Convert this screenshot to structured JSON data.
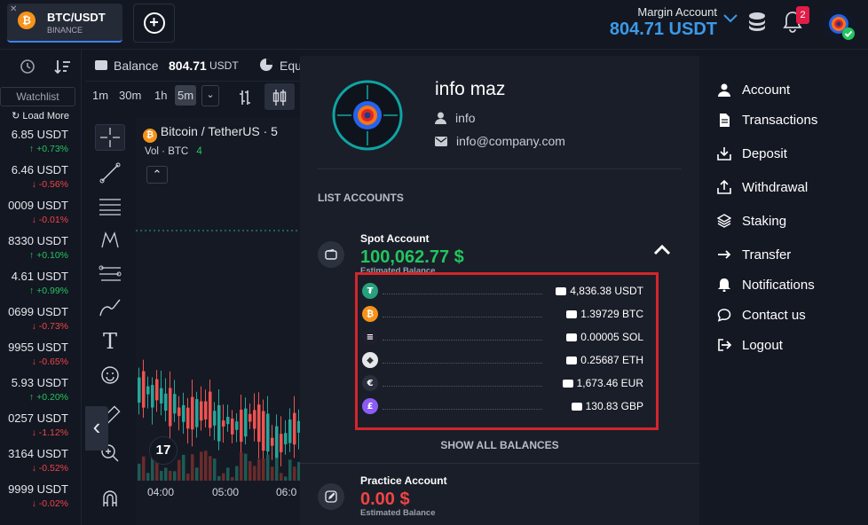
{
  "header": {
    "pair": {
      "symbol": "BTC/USDT",
      "exchange": "BINANCE",
      "coin_letter": "₿"
    },
    "margin_account_label": "Margin Account",
    "margin_account_value": "804.71 USDT",
    "notification_count": "2"
  },
  "sidebar": {
    "watchlist_label": "Watchlist",
    "load_more_label": "Load More",
    "tickers": [
      {
        "price": "6.85 USDT",
        "change": "↑ +0.73%",
        "dir": "up"
      },
      {
        "price": "6.46 USDT",
        "change": "↓ -0.56%",
        "dir": "down"
      },
      {
        "price": "0009 USDT",
        "change": "↓ -0.01%",
        "dir": "down"
      },
      {
        "price": "8330 USDT",
        "change": "↑ +0.10%",
        "dir": "up"
      },
      {
        "price": "4.61 USDT",
        "change": "↑ +0.99%",
        "dir": "up"
      },
      {
        "price": "0699 USDT",
        "change": "↓ -0.73%",
        "dir": "down"
      },
      {
        "price": "9955 USDT",
        "change": "↓ -0.65%",
        "dir": "down"
      },
      {
        "price": "5.93 USDT",
        "change": "↑ +0.20%",
        "dir": "up"
      },
      {
        "price": "0257 USDT",
        "change": "↓ -1.12%",
        "dir": "down"
      },
      {
        "price": "3164 USDT",
        "change": "↓ -0.52%",
        "dir": "down"
      },
      {
        "price": "9999 USDT",
        "change": "↓ -0.02%",
        "dir": "down"
      }
    ]
  },
  "chart_header": {
    "balance_label": "Balance",
    "balance_value": "804.71",
    "balance_unit": "USDT",
    "equity_label": "Equ"
  },
  "timeframes": [
    "1m",
    "30m",
    "1h",
    "5m"
  ],
  "chart": {
    "title": "Bitcoin / TetherUS · 5",
    "vol_label": "Vol · BTC",
    "vol_value": "4",
    "time_labels": [
      "04:00",
      "05:00",
      "06:0"
    ]
  },
  "profile": {
    "name": "info maz",
    "username": "info",
    "email": "info@company.com"
  },
  "accounts": {
    "list_label": "LIST ACCOUNTS",
    "spot": {
      "name": "Spot Account",
      "balance": "100,062.77 $",
      "sub": "Estimated Balance",
      "balance_color": "#22c55e"
    },
    "balances": [
      {
        "amount": "4,836.38 USDT",
        "icon": "tether-icon",
        "color": "#26a17b",
        "glyph": "₮"
      },
      {
        "amount": "1.39729 BTC",
        "icon": "bitcoin-icon",
        "color": "#f7931a",
        "glyph": "₿"
      },
      {
        "amount": "0.00005 SOL",
        "icon": "solana-icon",
        "color": "#1e1e2e",
        "glyph": "≡"
      },
      {
        "amount": "0.25687 ETH",
        "icon": "ethereum-icon",
        "color": "#e5e7eb",
        "glyph": "◆"
      },
      {
        "amount": "1,673.46 EUR",
        "icon": "euro-icon",
        "color": "#2a2f3d",
        "glyph": "€"
      },
      {
        "amount": "130.83 GBP",
        "icon": "pound-icon",
        "color": "#8b5cf6",
        "glyph": "£"
      }
    ],
    "show_all_label": "SHOW ALL BALANCES",
    "practice": {
      "name": "Practice Account",
      "balance": "0.00 $",
      "sub": "Estimated Balance",
      "balance_color": "#ef4444"
    }
  },
  "menu": {
    "items": [
      {
        "label": "Account",
        "icon": "user-icon"
      },
      {
        "label": "Transactions",
        "icon": "document-icon"
      },
      {
        "label": "Deposit",
        "icon": "deposit-icon"
      },
      {
        "label": "Withdrawal",
        "icon": "withdraw-icon"
      },
      {
        "label": "Staking",
        "icon": "layers-icon"
      },
      {
        "label": "Transfer",
        "icon": "transfer-icon"
      },
      {
        "label": "Notifications",
        "icon": "bell-icon"
      },
      {
        "label": "Contact us",
        "icon": "chat-icon"
      },
      {
        "label": "Logout",
        "icon": "logout-icon"
      }
    ]
  }
}
